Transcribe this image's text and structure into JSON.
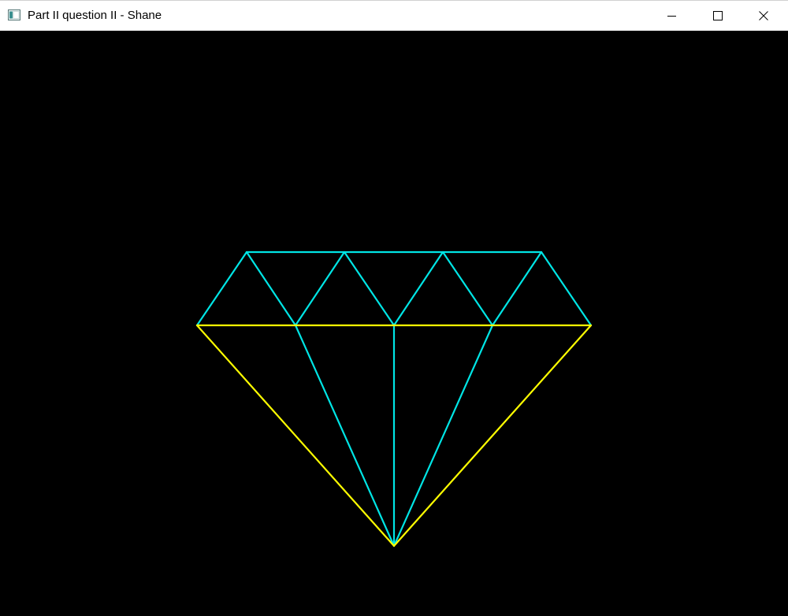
{
  "window": {
    "title": "Part II question II - Shane",
    "app_icon": "window-app-icon",
    "controls": {
      "minimize_icon": "minimize-icon",
      "maximize_icon": "maximize-icon",
      "close_icon": "close-icon"
    }
  },
  "canvas": {
    "background": "#000000",
    "drawing": "diamond-wireframe",
    "colors": {
      "outline": "#ffff00",
      "facets": "#00e5e5"
    }
  }
}
